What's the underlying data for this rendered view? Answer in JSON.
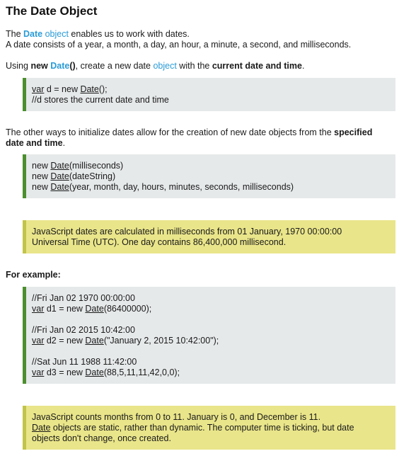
{
  "title": "The Date Object",
  "intro": {
    "pre": "The ",
    "date_word": "Date",
    "object_word": "object",
    "post": " enables us to work with dates.",
    "line2": "A date consists of a year, a month, a day, an hour, a minute, a second, and milliseconds."
  },
  "using": {
    "pre": "Using ",
    "new_word": "new",
    "date_word": "Date",
    "parens": "()",
    "mid": ", create a new date ",
    "object_word": "object",
    "mid2": " with the ",
    "bold_tail": "current date and time",
    "end": "."
  },
  "code1": {
    "line1_var": "var",
    "line1_mid": " d = new ",
    "line1_date": "Date",
    "line1_end": "();",
    "line2": "//d stores the current date and time"
  },
  "other_ways": {
    "pre": "The other ways to initialize dates allow for the creation of new date objects from the ",
    "bold_a": "specified",
    "bold_b": "date and time",
    "end": "."
  },
  "code2": {
    "new_word": "new ",
    "date_word": "Date",
    "args1": "(milliseconds)",
    "args2": "(dateString)",
    "args3": "(year, month, day, hours, minutes, seconds, milliseconds)"
  },
  "note1": {
    "line1": "JavaScript dates are calculated in milliseconds from 01 January, 1970 00:00:00",
    "line2": "Universal Time (UTC). One day contains 86,400,000 millisecond."
  },
  "example_label": "For example:",
  "code3": {
    "c1": "//Fri Jan 02 1970 00:00:00",
    "d1_var": "var",
    "d1_mid": " d1 = new ",
    "d1_date": "Date",
    "d1_end": "(86400000);",
    "c2": "//Fri Jan 02 2015 10:42:00",
    "d2_var": "var",
    "d2_mid": " d2 = new ",
    "d2_date": "Date",
    "d2_end": "(\"January 2, 2015 10:42:00\");",
    "c3": "//Sat Jun 11 1988 11:42:00",
    "d3_var": "var",
    "d3_mid": " d3 = new ",
    "d3_date": "Date",
    "d3_end": "(88,5,11,11,42,0,0);"
  },
  "note2": {
    "line1": "JavaScript counts months from 0 to 11. January is 0, and December is 11.",
    "line2_date": "Date",
    "line2_rest": " objects are static, rather than dynamic. The computer time is ticking, but date",
    "line3": "objects don't change, once created."
  },
  "colors": {
    "keyword_blue": "#2a9bd6",
    "code_bg": "#e6e9ea",
    "code_border": "#4c8f2f",
    "note_bg": "#e9e58a",
    "note_border": "#c2c44a"
  }
}
